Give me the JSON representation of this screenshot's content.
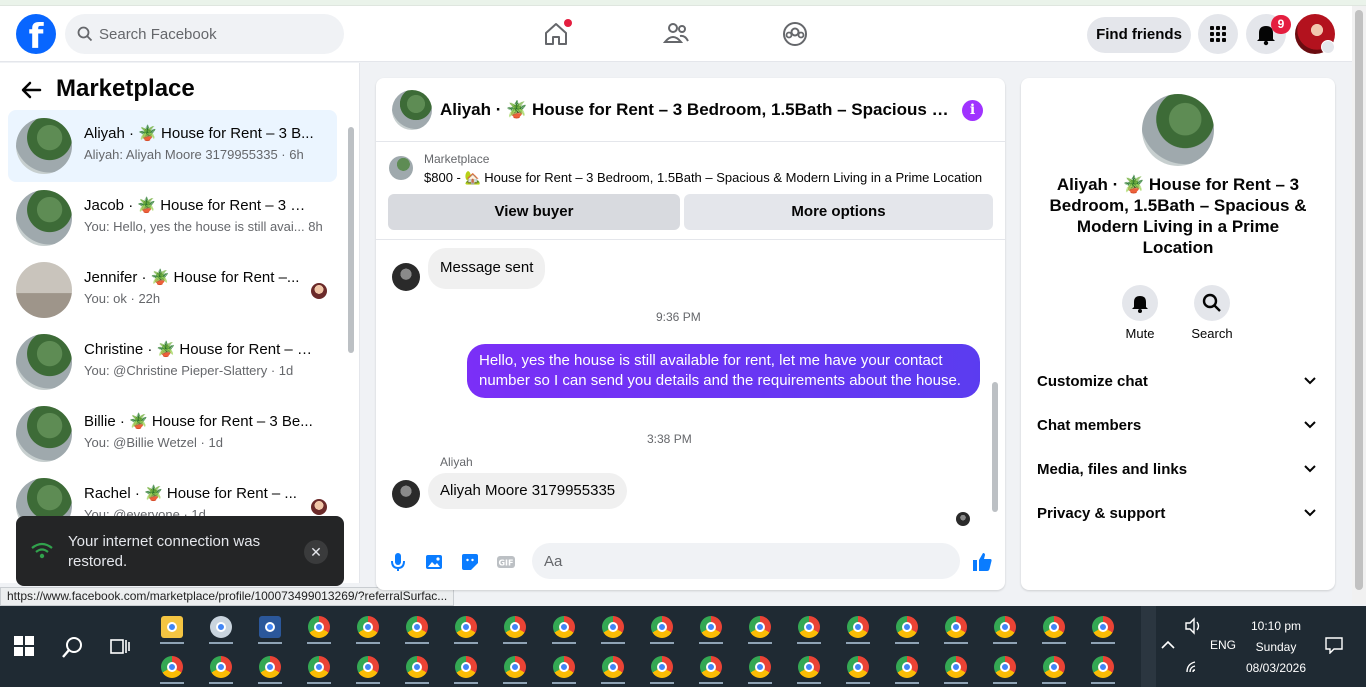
{
  "header": {
    "logo": "f",
    "search_placeholder": "Search Facebook",
    "find_friends": "Find friends",
    "notification_count": "9",
    "icons": [
      "home-icon",
      "friends-icon",
      "groups-icon",
      "menu-grid-icon",
      "bell-icon"
    ]
  },
  "sidebar": {
    "title": "Marketplace",
    "conversations": [
      {
        "name": "Aliyah · 🪴 House for Rent – 3 B...",
        "sub": "Aliyah: Aliyah Moore 3179955335 · 6h",
        "active": true
      },
      {
        "name": "Jacob · 🪴 House for Rent – 3 Be...",
        "sub": "You: Hello, yes the house is still avai... 8h"
      },
      {
        "name": "Jennifer · 🪴 House for Rent –...",
        "sub": "You: ok · 22h"
      },
      {
        "name": "Christine · 🪴 House for Rent – 3...",
        "sub": "You: @Christine Pieper-Slattery · 1d"
      },
      {
        "name": "Billie · 🪴 House for Rent – 3 Be...",
        "sub": "You: @Billie Wetzel · 1d"
      },
      {
        "name": "Rachel · 🪴 House for Rent – ...",
        "sub": "You: @everyone · 1d"
      }
    ]
  },
  "toast": {
    "text": "Your internet connection was restored."
  },
  "status_url": "https://www.facebook.com/marketplace/profile/100073499013269/?referralSurfac...",
  "chat": {
    "title": "Aliyah · 🪴 House for Rent – 3 Bedroom, 1.5Bath – Spacious & M···",
    "listing_source": "Marketplace",
    "listing_title": "$800 - 🏡 House for Rent – 3 Bedroom, 1.5Bath – Spacious & Modern Living in a Prime Location",
    "view_buyer": "View buyer",
    "more_options": "More options",
    "msg1": "Message sent",
    "time1": "9:36 PM",
    "msg2": "Hello, yes the house is still available for rent, let me have your contact number so I can send you details and the requirements about the house.",
    "time2": "3:38 PM",
    "sender": "Aliyah",
    "msg3": "Aliyah Moore 3179955335",
    "composer_placeholder": "Aa"
  },
  "details": {
    "title": "Aliyah · 🪴 House for Rent – 3 Bedroom, 1.5Bath – Spacious & Modern Living in a Prime Location",
    "mute": "Mute",
    "search": "Search",
    "sections": [
      "Customize chat",
      "Chat members",
      "Media, files and links",
      "Privacy & support"
    ]
  },
  "taskbar": {
    "time": "10:10 pm",
    "day": "Sunday",
    "date": "08/03/2026",
    "lang": "ENG"
  },
  "colors": {
    "brand": "#0866ff",
    "accent": "#a033ff",
    "bubble_out": "#6a35f3"
  }
}
